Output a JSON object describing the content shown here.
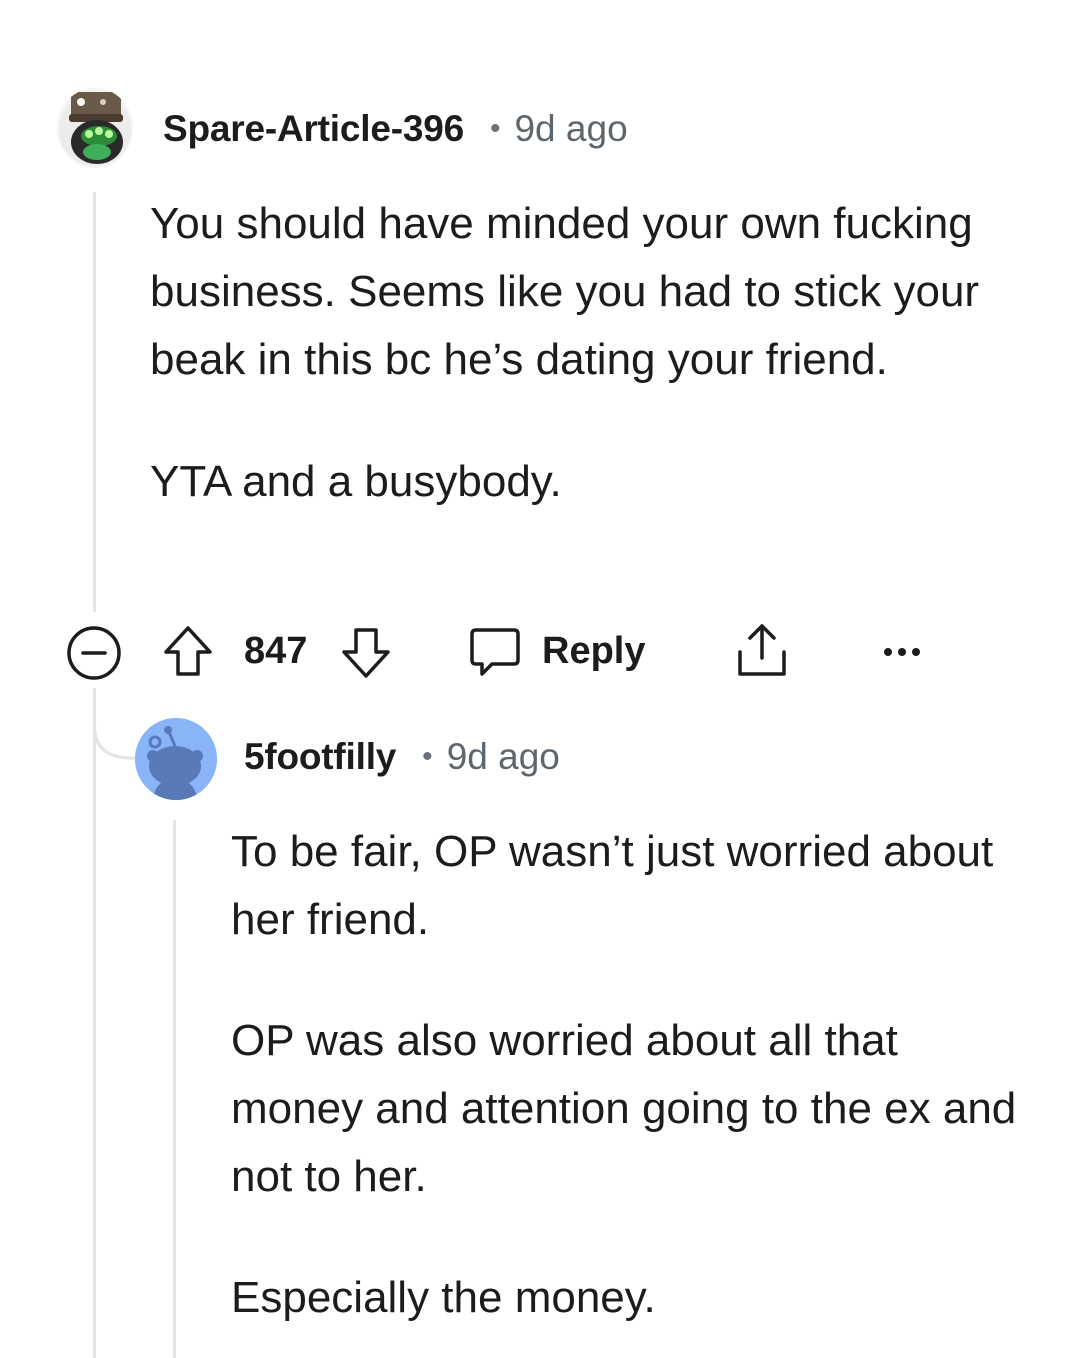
{
  "comments": [
    {
      "username": "Spare-Article-396",
      "separator": "•",
      "time": "9d ago",
      "body": [
        "You should have minded your own fucking business. Seems like you had to stick your beak in this bc he’s dating your friend.",
        "YTA and a busybody."
      ],
      "actions": {
        "votes": "847",
        "reply_label": "Reply",
        "upvote_icon": "arrow-up-icon",
        "downvote_icon": "arrow-down-icon",
        "reply_icon": "speech-bubble-icon",
        "share_icon": "share-icon",
        "more_icon": "ellipsis-icon",
        "collapse_icon": "minus-circle-icon"
      }
    },
    {
      "username": "5footfilly",
      "separator": "•",
      "time": "9d ago",
      "body": [
        "To be fair, OP wasn’t just worried about her friend.",
        "OP was also worried about all that money and attention going to the ex and not to her.",
        "Especially the money."
      ]
    }
  ],
  "colors": {
    "thread_line": "#e2e4e6",
    "meta_gray": "#5e666d",
    "default_avatar_bg": "#8ab4f8",
    "snoo_body": "#5a79b8"
  }
}
